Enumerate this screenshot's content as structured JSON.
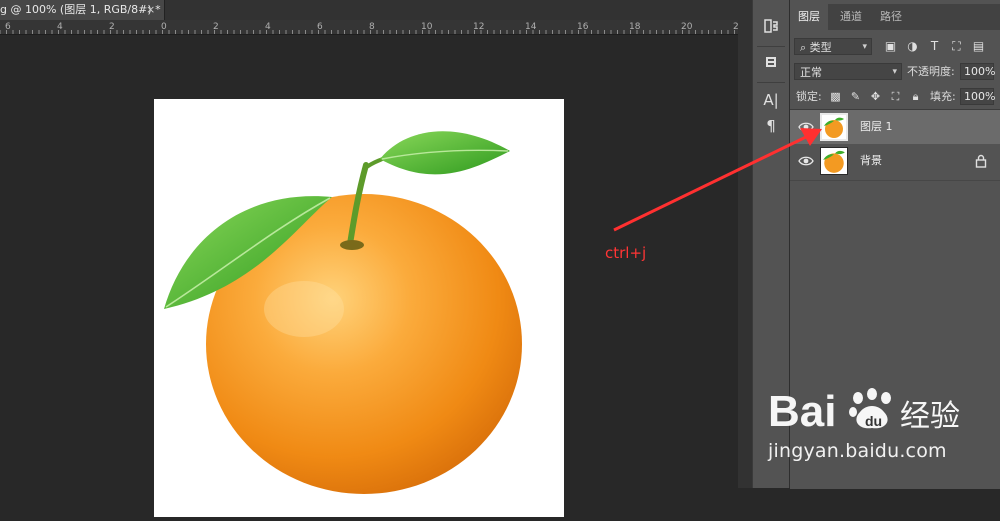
{
  "document": {
    "tab_title": "g @ 100% (图层 1, RGB/8#) *",
    "close_glyph": "×"
  },
  "ruler": {
    "top_labels": [
      "6",
      "4",
      "2",
      "0",
      "2",
      "4",
      "6",
      "8",
      "10",
      "12",
      "14",
      "16",
      "18",
      "20",
      "22"
    ]
  },
  "tool_strip": {
    "items": [
      {
        "icon": "history-icon"
      },
      {
        "icon": "properties-icon"
      },
      {
        "icon": "character-icon",
        "glyph": "A|"
      },
      {
        "icon": "paragraph-icon",
        "glyph": "¶"
      }
    ]
  },
  "layers_panel": {
    "tabs": [
      {
        "label": "图层",
        "active": true
      },
      {
        "label": "通道",
        "active": false
      },
      {
        "label": "路径",
        "active": false
      }
    ],
    "filter": {
      "kind_label": "类型",
      "icons": [
        "image-filter-icon",
        "adjustment-filter-icon",
        "type-filter-icon",
        "shape-filter-icon",
        "smart-object-filter-icon"
      ]
    },
    "blend_mode": "正常",
    "opacity_label": "不透明度:",
    "opacity_value": "100%",
    "lock_label": "锁定:",
    "lock_icons": [
      "lock-transparent-icon",
      "lock-paint-icon",
      "lock-position-icon",
      "lock-artboard-icon",
      "lock-all-icon"
    ],
    "fill_label": "填充:",
    "fill_value": "100%",
    "layers": [
      {
        "name": "图层 1",
        "selected": true,
        "visible": true,
        "locked": false
      },
      {
        "name": "背景",
        "selected": false,
        "visible": true,
        "locked": true
      }
    ]
  },
  "annotation": {
    "label": "ctrl+j",
    "color": "#ff3535"
  },
  "watermark": {
    "brand": "Bai du 经验",
    "url": "jingyan.baidu.com"
  },
  "colors": {
    "workspace": "#282828",
    "panel": "#535353",
    "selected_layer": "#6b6b6b",
    "orange": "#f7931e",
    "leaf": "#3fae2a"
  }
}
